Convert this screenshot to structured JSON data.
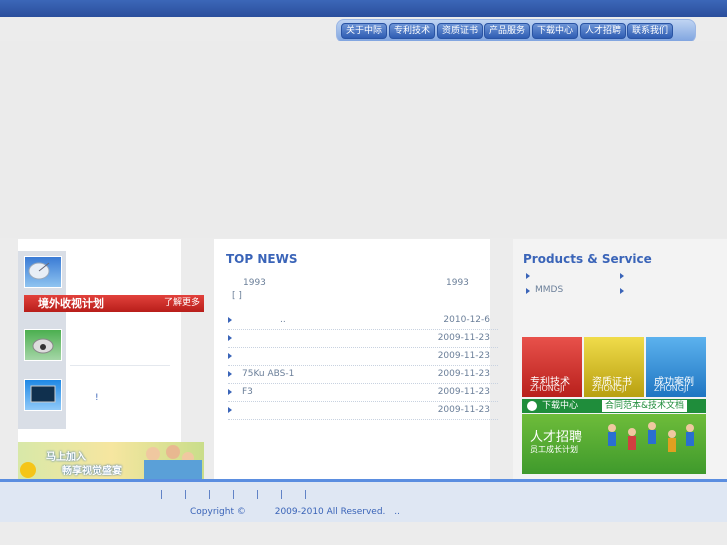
{
  "nav": {
    "items": [
      {
        "label": "关于中际"
      },
      {
        "label": "专利技术"
      },
      {
        "label": "资质证书"
      },
      {
        "label": "产品服务"
      },
      {
        "label": "下载中心"
      },
      {
        "label": "人才招聘"
      },
      {
        "label": "联系我们"
      }
    ]
  },
  "left": {
    "banner_text": "境外收视计划",
    "more_text": "了解更多",
    "exclaim": "!",
    "promo_line1": "马上加入",
    "promo_line2": "畅享视觉盛宴"
  },
  "news": {
    "heading": "TOP NEWS",
    "intro_year_1": "1993",
    "intro_year_2": "1993",
    "intro_bracket": "[ ]",
    "items": [
      {
        "title": "..",
        "date": "2010-12-6"
      },
      {
        "title": "",
        "date": "2009-11-23"
      },
      {
        "title": "",
        "date": "2009-11-23"
      },
      {
        "title": "75Ku ABS-1",
        "date": "2009-11-23"
      },
      {
        "title": "F3",
        "date": "2009-11-23"
      },
      {
        "title": "",
        "date": "2009-11-23"
      }
    ]
  },
  "products": {
    "heading": "Products & Service",
    "item_mmds": "MMDS",
    "tiles": [
      {
        "label": "专利技术",
        "sub": "ZHONGJI",
        "color": "#d9302b"
      },
      {
        "label": "资质证书",
        "sub": "ZHONGJI",
        "color": "#d8c21c"
      },
      {
        "label": "成功案例",
        "sub": "ZHONGJI",
        "color": "#2a8fd6"
      }
    ],
    "download_label": "下载中心",
    "docs_label": "合同范本&技术文档",
    "career_title": "人才招聘",
    "career_sub": "员工成长计划"
  },
  "footer": {
    "links": [
      "|",
      "|",
      "|",
      "|",
      "|",
      "|",
      "|"
    ],
    "copyright_prefix": "Copyright ©",
    "copyright_years": "2009-2010 All Reserved.",
    "copyright_suffix": ".."
  }
}
